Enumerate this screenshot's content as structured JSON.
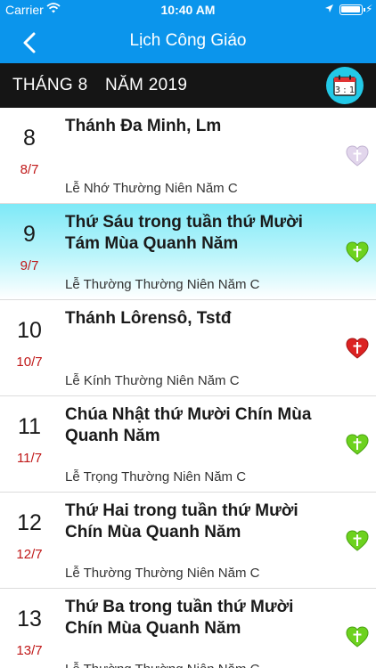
{
  "status_bar": {
    "carrier": "Carrier",
    "time": "10:40 AM"
  },
  "nav": {
    "title": "Lịch Công Giáo",
    "back_icon": "chevron-left-icon"
  },
  "month_bar": {
    "month_label": "THÁNG 8",
    "year_label": "NĂM 2019",
    "calendar_icon_text": "3 : 1"
  },
  "colors": {
    "nav": "#0b95ec",
    "month_bar": "#151515",
    "lunar": "#c01818",
    "heart_white": "#e2d6ec",
    "heart_green": "#6dd21e",
    "heart_red": "#dc2222"
  },
  "days": [
    {
      "day": "8",
      "lunar": "8/7",
      "name": "Thánh Đa Minh, Lm",
      "rank": "Lễ Nhớ Thường Niên Năm C",
      "heart": "white",
      "highlight": false
    },
    {
      "day": "9",
      "lunar": "9/7",
      "name": "Thứ Sáu trong tuần thứ Mười Tám Mùa Quanh Năm",
      "rank": "Lễ Thường Thường Niên Năm C",
      "heart": "green",
      "highlight": true
    },
    {
      "day": "10",
      "lunar": "10/7",
      "name": "Thánh Lôrensô, Tstđ",
      "rank": "Lễ Kính Thường Niên Năm C",
      "heart": "red",
      "highlight": false
    },
    {
      "day": "11",
      "lunar": "11/7",
      "name": "Chúa Nhật thứ Mười Chín Mùa Quanh Năm",
      "rank": "Lễ Trọng Thường Niên Năm C",
      "heart": "green",
      "highlight": false
    },
    {
      "day": "12",
      "lunar": "12/7",
      "name": "Thứ Hai trong tuần thứ Mười Chín Mùa Quanh Năm",
      "rank": "Lễ Thường Thường Niên Năm C",
      "heart": "green",
      "highlight": false
    },
    {
      "day": "13",
      "lunar": "13/7",
      "name": "Thứ Ba trong tuần thứ Mười Chín Mùa Quanh Năm",
      "rank": "Lễ Thường Thường Niên Năm C",
      "heart": "green",
      "highlight": false
    }
  ]
}
